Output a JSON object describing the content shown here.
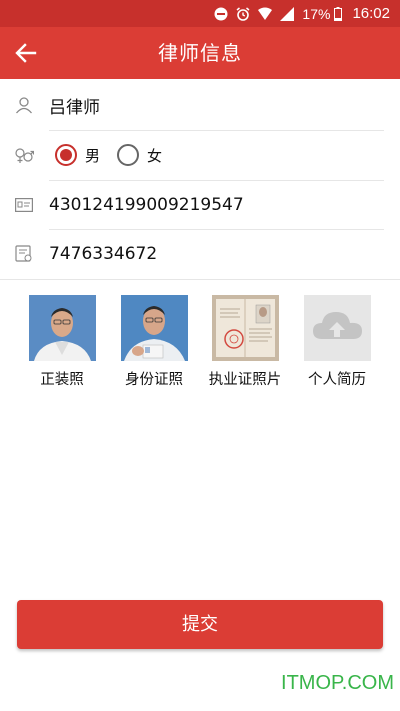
{
  "status_bar": {
    "battery": "17%",
    "time": "16:02",
    "icons": [
      "do-not-disturb-icon",
      "alarm-icon",
      "wifi-icon",
      "signal-icon",
      "battery-icon"
    ]
  },
  "header": {
    "title": "律师信息",
    "back_icon": "arrow-left-icon"
  },
  "form": {
    "name": {
      "value": "吕律师",
      "icon": "person-icon"
    },
    "gender": {
      "icon": "gender-icon",
      "options": [
        {
          "label": "男",
          "selected": true
        },
        {
          "label": "女",
          "selected": false
        }
      ]
    },
    "id_number": {
      "value": "430124199009219547",
      "icon": "id-card-icon"
    },
    "license_number": {
      "value": "7476334672",
      "icon": "license-icon"
    }
  },
  "photos": [
    {
      "label": "正装照"
    },
    {
      "label": "身份证照"
    },
    {
      "label": "执业证照片"
    },
    {
      "label": "个人简历",
      "icon": "cloud-upload-icon"
    }
  ],
  "submit_label": "提交",
  "watermark": "ITMOP.COM",
  "colors": {
    "primary": "#db3d35",
    "status_bar": "#c7302c",
    "watermark": "#39b54a"
  }
}
